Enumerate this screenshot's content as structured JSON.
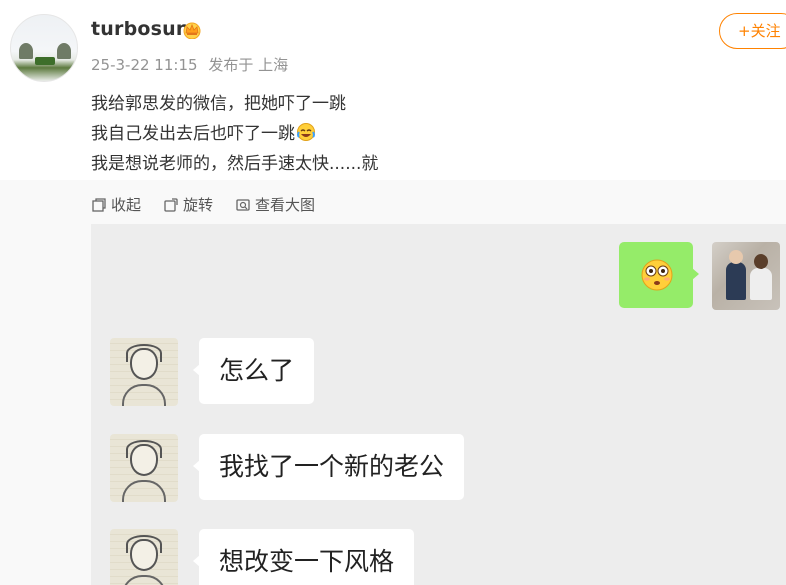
{
  "post": {
    "username": "turbosun",
    "timestamp": "25-3-22 11:15",
    "source": "发布于 上海",
    "follow_label": "+关注",
    "text_lines": [
      "我给郭思发的微信，把她吓了一跳",
      "我自己发出去后也吓了一跳",
      "我是想说老师的，然后手速太快......就"
    ],
    "badge_icon": "crown-icon",
    "inline_emoji": "laughing-crying-emoji"
  },
  "toolbar": {
    "collapse_label": "收起",
    "rotate_label": "旋转",
    "view_large_label": "查看大图"
  },
  "chat": {
    "sent_emoji": "flushed-face-emoji",
    "received": [
      {
        "text": "怎么了"
      },
      {
        "text": "我找了一个新的老公"
      },
      {
        "text": "想改变一下风格"
      }
    ]
  },
  "colors": {
    "accent": "#ff8200",
    "sent_bubble": "#95ec69",
    "chat_bg": "#ededed"
  }
}
